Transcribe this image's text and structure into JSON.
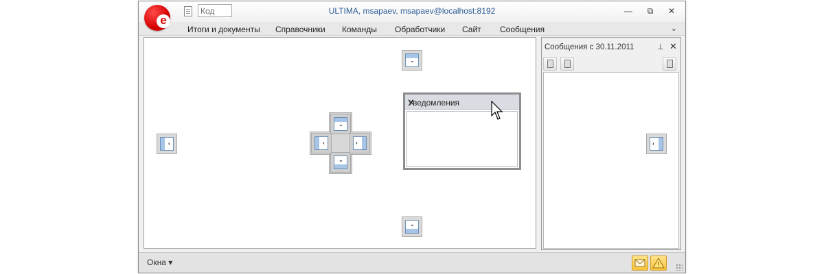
{
  "window": {
    "title": "ULTIMA, msapaev, msapaev@localhost:8192",
    "logo_letter": "e",
    "code_placeholder": "Код",
    "controls": {
      "minimize": "—",
      "restore": "⧉",
      "close": "✕"
    }
  },
  "menu": {
    "items": [
      "Итоги и документы",
      "Справочники",
      "Команды",
      "Обработчики",
      "Сайт",
      "Сообщения"
    ],
    "chevron": "⌄"
  },
  "right_panel": {
    "title": "Сообщения с 30.11.2011",
    "pin_icon": "pin-icon",
    "close_icon": "close-icon",
    "close": "✕",
    "pin": "⊥"
  },
  "floating_panel": {
    "title": "Уведомления",
    "close": "✕"
  },
  "statusbar": {
    "windows_label": "Окна ▾",
    "mail_icon": "envelope-icon",
    "warning_icon": "warning-icon"
  },
  "colors": {
    "accent": "#2c5b96",
    "brand": "#d60000",
    "status_button": "#f5c23c"
  }
}
